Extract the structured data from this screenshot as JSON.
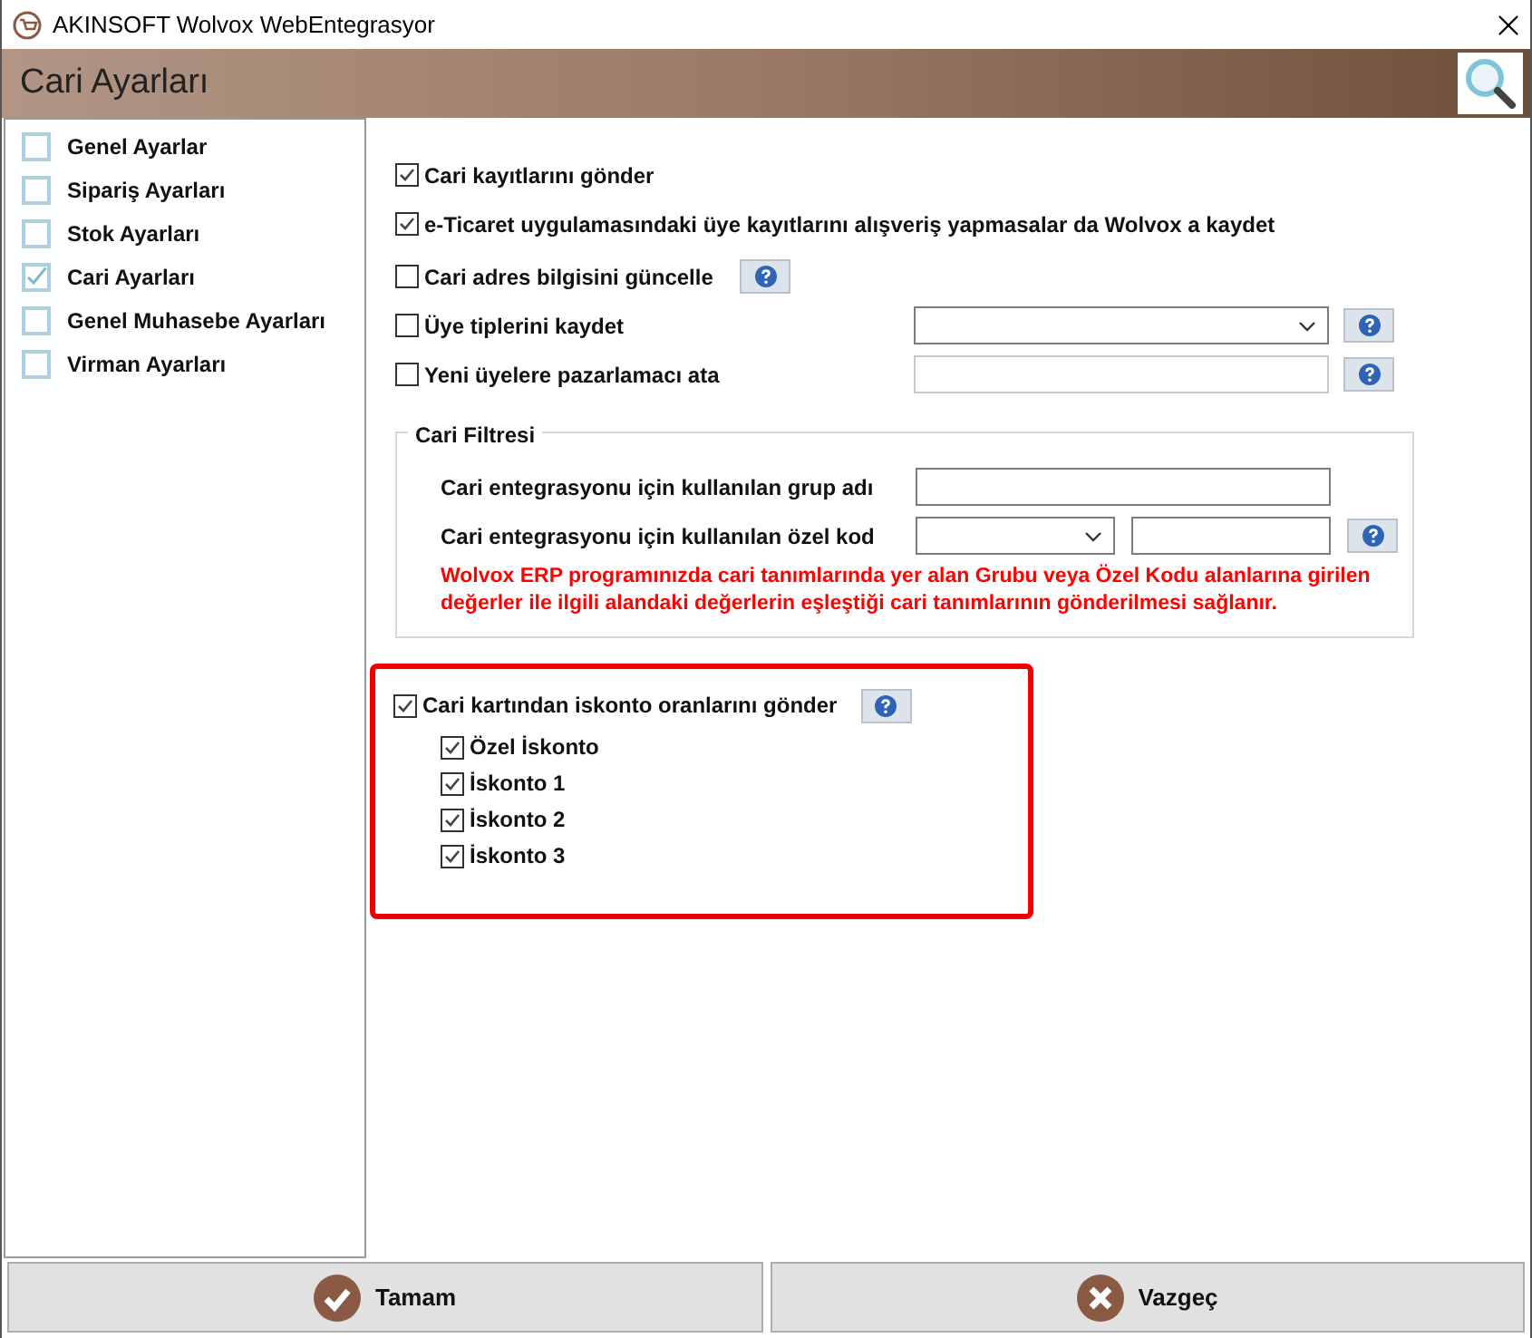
{
  "window": {
    "title": "AKINSOFT Wolvox WebEntegrasyor"
  },
  "header": {
    "title": "Cari Ayarları"
  },
  "sidebar": {
    "items": [
      {
        "label": "Genel Ayarlar",
        "checked": false
      },
      {
        "label": "Sipariş Ayarları",
        "checked": false
      },
      {
        "label": "Stok Ayarları",
        "checked": false
      },
      {
        "label": "Cari Ayarları",
        "checked": true
      },
      {
        "label": "Genel Muhasebe Ayarları",
        "checked": false
      },
      {
        "label": "Virman Ayarları",
        "checked": false
      }
    ]
  },
  "options": [
    {
      "label": "Cari kayıtlarını gönder",
      "checked": true,
      "kind": "plain"
    },
    {
      "label": "e-Ticaret uygulamasındaki üye kayıtlarını alışveriş yapmasalar da Wolvox a kaydet",
      "checked": true,
      "kind": "plain"
    },
    {
      "label": "Cari adres bilgisini güncelle",
      "checked": false,
      "kind": "help"
    },
    {
      "label": "Üye tiplerini kaydet",
      "checked": false,
      "kind": "select"
    },
    {
      "label": "Yeni üyelere pazarlamacı ata",
      "checked": false,
      "kind": "input"
    }
  ],
  "filter": {
    "title": "Cari Filtresi",
    "rows": [
      {
        "label": "Cari entegrasyonu için kullanılan grup adı",
        "kind": "input"
      },
      {
        "label": "Cari entegrasyonu için kullanılan özel kod",
        "kind": "select_input"
      }
    ],
    "note": "Wolvox ERP programınızda cari tanımlarında yer alan Grubu veya Özel Kodu alanlarına girilen değerler ile ilgili alandaki değerlerin eşleştiği cari tanımlarının gönderilmesi sağlanır."
  },
  "discount": {
    "label": "Cari kartından iskonto oranlarını gönder",
    "checked": true,
    "items": [
      {
        "label": "Özel İskonto",
        "checked": true
      },
      {
        "label": "İskonto 1",
        "checked": true
      },
      {
        "label": "İskonto 2",
        "checked": true
      },
      {
        "label": "İskonto 3",
        "checked": true
      }
    ]
  },
  "buttons": [
    {
      "label": "Tamam",
      "kind": "ok"
    },
    {
      "label": "Vazgeç",
      "kind": "cancel"
    }
  ]
}
